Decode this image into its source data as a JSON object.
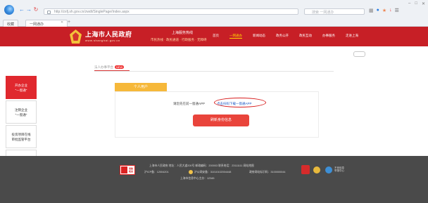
{
  "browser": {
    "address": "http://zxfj.sh.gov.cn/zwdt/SinglePage/Index.aspx",
    "search_placeholder": "搜索 一网通办",
    "tabs": [
      {
        "label": "收藏"
      },
      {
        "label": "一网通办"
      }
    ]
  },
  "header": {
    "title": "上海市人民政府",
    "url_text": "www.shanghai.gov.cn",
    "top_text": "上海服务热线",
    "links": "市民热线 · 政民通道 · 行政服务 · 无障碍",
    "nav": [
      {
        "label": "首页",
        "active": false
      },
      {
        "label": "一网通办",
        "active": true
      },
      {
        "label": "新闻动态",
        "active": false
      },
      {
        "label": "政务公开",
        "active": false
      },
      {
        "label": "政民互动",
        "active": false
      },
      {
        "label": "办事服务",
        "active": false
      },
      {
        "label": "走进上海",
        "active": false
      }
    ]
  },
  "breadcrumb": {
    "label": "法人办事平台",
    "badge": "NEW"
  },
  "sidebar": [
    {
      "label": "开办企业\n\"一窗通\"",
      "active": true
    },
    {
      "label": "注销企业\n\"一窗通\"",
      "active": false
    },
    {
      "label": "投资项目在线\n审批监管平台",
      "active": false
    },
    {
      "label": "建设工程联\n审共享平台",
      "active": false
    },
    {
      "label": "企业服务云",
      "active": false
    }
  ],
  "content": {
    "tab_label": "个人用户",
    "notice": "请您先在前一窗通APP",
    "download_link": "点击扫码下载一窗通APP",
    "refresh_button": "刷新身份信息"
  },
  "footer": {
    "badge": "党政机关",
    "line1": "上海市人民政府   地址：人民大道200号   邮政编码：200003   联系电话：23111111   网站地图",
    "line2_a": "沪ICP备：12004201",
    "line2_b": "沪公网安备：31010102004448",
    "line2_c": "政府网站标识码：3100000044",
    "line3": "上海市信息中心主办：12345",
    "emblem3_text": "不良信息\n举报中心"
  },
  "colors": {
    "header_red": "#c71f26",
    "accent_orange": "#f6b83a",
    "button_red": "#e9443b",
    "link_blue": "#1a56c4",
    "footer_gray": "#4a4a4a"
  }
}
